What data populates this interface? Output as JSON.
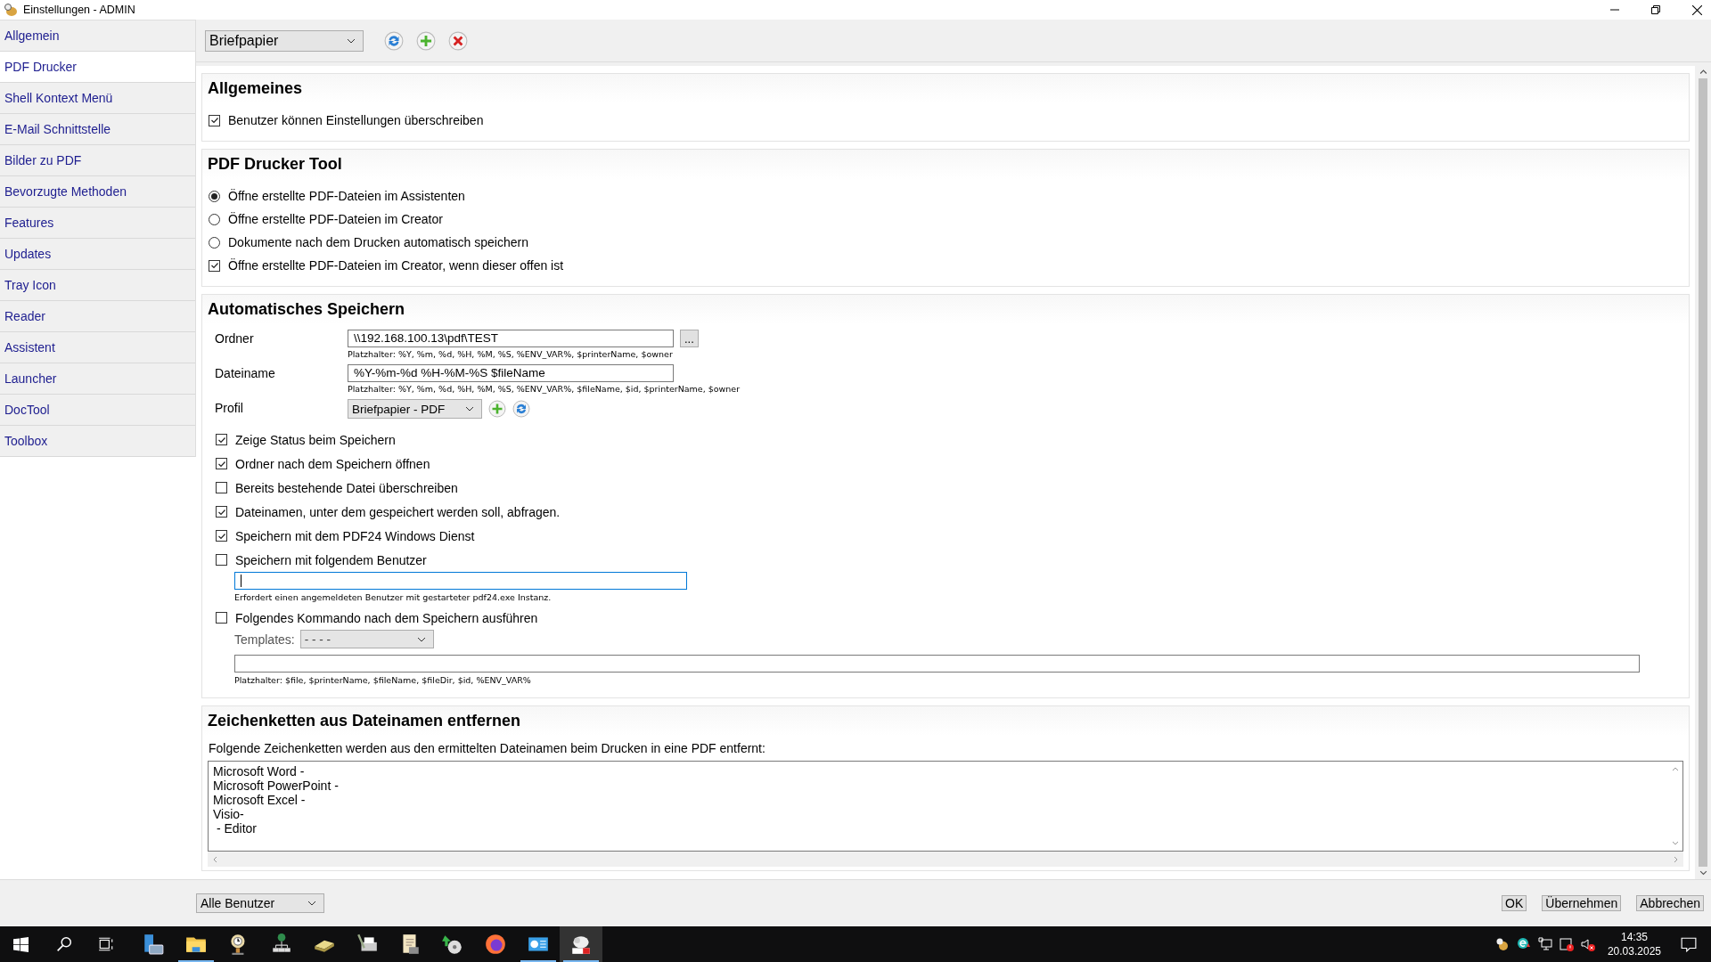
{
  "window": {
    "title": "Einstellungen - ADMIN"
  },
  "sidebar": {
    "items": [
      {
        "label": "Allgemein",
        "selected": false
      },
      {
        "label": "PDF Drucker",
        "selected": true
      },
      {
        "label": "Shell Kontext Menü",
        "selected": false
      },
      {
        "label": "E-Mail Schnittstelle",
        "selected": false
      },
      {
        "label": "Bilder zu PDF",
        "selected": false
      },
      {
        "label": "Bevorzugte Methoden",
        "selected": false
      },
      {
        "label": "Features",
        "selected": false
      },
      {
        "label": "Updates",
        "selected": false
      },
      {
        "label": "Tray Icon",
        "selected": false
      },
      {
        "label": "Reader",
        "selected": false
      },
      {
        "label": "Assistent",
        "selected": false
      },
      {
        "label": "Launcher",
        "selected": false
      },
      {
        "label": "DocTool",
        "selected": false
      },
      {
        "label": "Toolbox",
        "selected": false
      }
    ]
  },
  "toolbar": {
    "preset": "Briefpapier"
  },
  "general": {
    "title": "Allgemeines",
    "options": [
      {
        "label": "Benutzer können Einstellungen überschreiben",
        "checked": true
      }
    ]
  },
  "pdf_tool": {
    "title": "PDF Drucker Tool",
    "options": [
      {
        "kind": "radio",
        "label": "Öffne erstellte PDF-Dateien im Assistenten",
        "selected": true
      },
      {
        "kind": "radio",
        "label": "Öffne erstellte PDF-Dateien im Creator",
        "selected": false
      },
      {
        "kind": "radio",
        "label": "Dokumente nach dem Drucken automatisch speichern",
        "selected": false
      },
      {
        "kind": "checkbox",
        "label": "Öffne erstellte PDF-Dateien im Creator, wenn dieser offen ist",
        "checked": true
      }
    ]
  },
  "auto_save": {
    "title": "Automatisches Speichern",
    "fields": [
      {
        "label": "Ordner",
        "value": "\\\\192.168.100.13\\pdf\\TEST",
        "browse_button": "...",
        "hint": "Platzhalter: %Y, %m, %d, %H, %M, %S, %ENV_VAR%, $printerName, $owner"
      },
      {
        "label": "Dateiname",
        "value": "%Y-%m-%d %H-%M-%S $fileName",
        "hint": "Platzhalter: %Y, %m, %d, %H, %M, %S, %ENV_VAR%, $fileName, $id, $printerName, $owner"
      }
    ],
    "profile": {
      "label": "Profil",
      "value": "Briefpapier - PDF"
    },
    "options": [
      {
        "kind": "plain",
        "label": "Zeige Status beim Speichern",
        "checked": true
      },
      {
        "kind": "plain",
        "label": "Ordner nach dem Speichern öffnen",
        "checked": true
      },
      {
        "kind": "plain",
        "label": "Bereits bestehende Datei überschreiben",
        "checked": false
      },
      {
        "kind": "plain",
        "label": "Dateinamen, unter dem gespeichert werden soll, abfragen.",
        "checked": true
      },
      {
        "kind": "plain",
        "label": "Speichern mit dem PDF24 Windows Dienst",
        "checked": true
      },
      {
        "kind": "user",
        "label": "Speichern mit folgendem Benutzer",
        "checked": false,
        "focused": true,
        "note": "Erfordert einen angemeldeten Benutzer mit gestarteter pdf24.exe Instanz."
      },
      {
        "kind": "command",
        "label": "Folgendes Kommando nach dem Speichern ausführen",
        "checked": false,
        "templates_label": "Templates:",
        "templates_value": "- - - -",
        "hint": "Platzhalter: $file, $printerName, $fileName, $fileDir, $id, %ENV_VAR%"
      }
    ]
  },
  "strip": {
    "title": "Zeichenketten aus Dateinamen entfernen",
    "description": "Folgende Zeichenketten werden aus den ermittelten Dateinamen beim Drucken in eine PDF entfernt:",
    "lines": [
      "Microsoft Word -",
      "Microsoft PowerPoint -",
      "Microsoft Excel -",
      "Visio-",
      " - Editor"
    ]
  },
  "bottom": {
    "scope": "Alle Benutzer",
    "buttons": [
      "OK",
      "Übernehmen",
      "Abbrechen"
    ]
  },
  "taskbar": {
    "apps": [
      {
        "kind": "server",
        "running": false,
        "selected": false
      },
      {
        "kind": "folder",
        "running": true,
        "selected": false
      },
      {
        "kind": "clock",
        "running": false,
        "selected": false
      },
      {
        "kind": "network",
        "running": false,
        "selected": false
      },
      {
        "kind": "scanner",
        "running": false,
        "selected": false
      },
      {
        "kind": "printer",
        "running": false,
        "selected": false
      },
      {
        "kind": "scroll",
        "running": false,
        "selected": false
      },
      {
        "kind": "disc",
        "running": false,
        "selected": false
      },
      {
        "kind": "browser",
        "running": false,
        "selected": false
      },
      {
        "kind": "panel",
        "running": true,
        "selected": false
      },
      {
        "kind": "pdf",
        "running": true,
        "selected": true
      }
    ],
    "time": "14:35",
    "date": "20.03.2025"
  }
}
